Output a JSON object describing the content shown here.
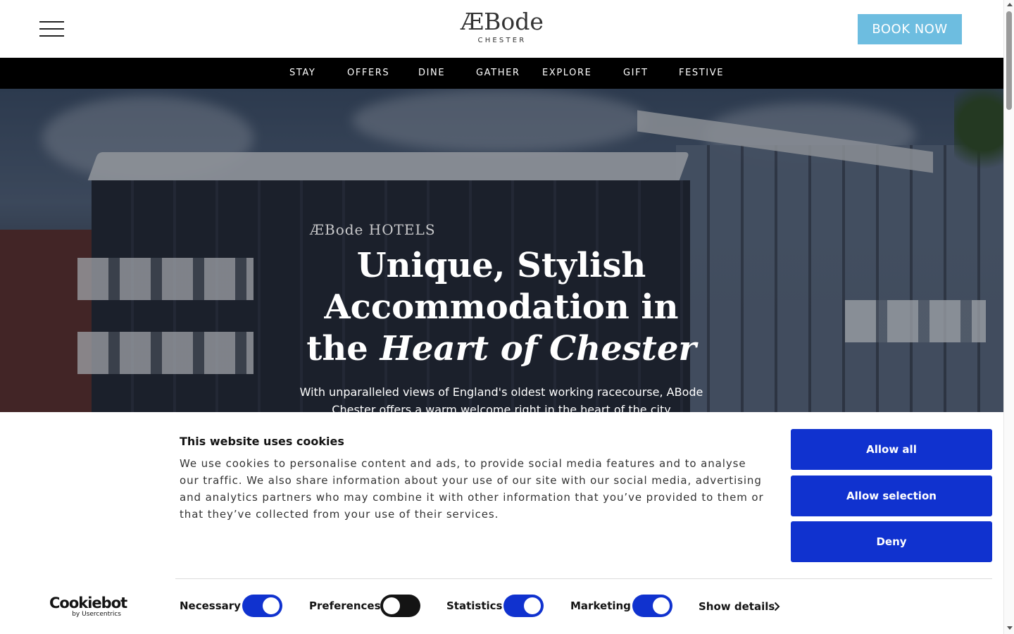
{
  "header": {
    "menu_icon": "hamburger-menu-icon",
    "logo_main": "ÆBode",
    "logo_sub": "CHESTER",
    "book_now": "BOOK NOW",
    "book_color": "#6dbde0"
  },
  "nav": {
    "items": [
      "STAY",
      "OFFERS",
      "DINE",
      "GATHER",
      "EXPLORE",
      "GIFT",
      "FESTIVE"
    ]
  },
  "hero": {
    "sign": "ÆBode HOTELS",
    "title_line1": "Unique, Stylish",
    "title_line2": "Accommodation in",
    "title_line3_plain": "the ",
    "title_line3_italic": "Heart of Chester",
    "subtitle": "With unparalleled views of England's oldest working racecourse, ABode Chester offers a warm welcome right in the heart of the city"
  },
  "cookie": {
    "title": "This website uses cookies",
    "text": "We use cookies to personalise content and ads, to provide social media features and to analyse our traffic. We also share information about your use of our site with our social media, advertising and analytics partners who may combine it with other information that you’ve provided to them or that they’ve collected from your use of their services.",
    "allow_all": "Allow all",
    "allow_selection": "Allow selection",
    "deny": "Deny",
    "button_color": "#1032cf",
    "logo_main": "Cookiebot",
    "logo_sub": "by Usercentrics",
    "toggles": [
      {
        "label": "Necessary",
        "on": true
      },
      {
        "label": "Preferences",
        "on": false
      },
      {
        "label": "Statistics",
        "on": true
      },
      {
        "label": "Marketing",
        "on": true
      }
    ],
    "show_details": "Show details"
  }
}
